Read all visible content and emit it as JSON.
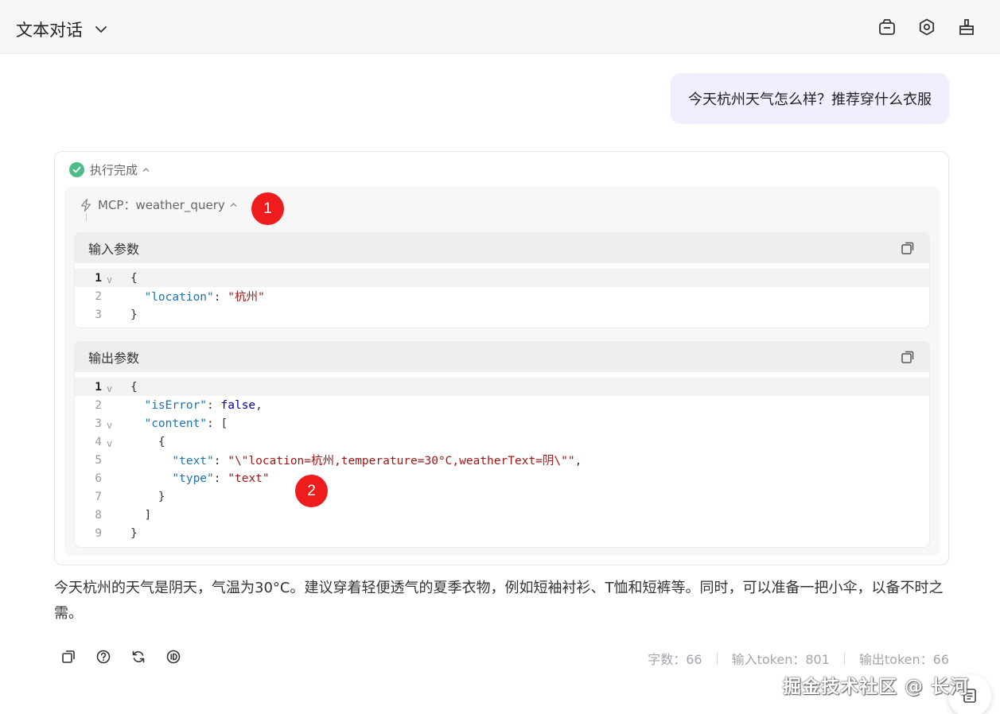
{
  "header": {
    "title": "文本对话",
    "icons": [
      "bag-icon",
      "gear-icon",
      "broom-icon"
    ]
  },
  "user_message": "今天杭州天气怎么样？推荐穿什么衣服",
  "execution": {
    "status": "执行完成",
    "status_color": "#4cbd87",
    "mcp_label": "MCP：weather_query",
    "badge_1": "1",
    "badge_2": "2",
    "input_block": {
      "title": "输入参数",
      "line_numbers": [
        "1",
        "2",
        "3"
      ]
    },
    "output_block": {
      "title": "输出参数",
      "line_numbers": [
        "1",
        "2",
        "3",
        "4",
        "5",
        "6",
        "7",
        "8",
        "9"
      ]
    },
    "input_code": {
      "key_location": "\"location\"",
      "val_location": "\"杭州\""
    },
    "output_code": {
      "key_isError": "\"isError\"",
      "val_isError": "false",
      "key_content": "\"content\"",
      "key_text": "\"text\"",
      "val_text": "\"\\\"location=杭州,temperature=30°C,weatherText=阴\\\"\"",
      "key_type": "\"type\"",
      "val_type": "\"text\""
    },
    "symbols": {
      "open_brace": "{",
      "close_brace": "}",
      "open_bracket": "[",
      "close_bracket": "]",
      "colon": ": ",
      "comma": ",",
      "fold_marker": "v"
    }
  },
  "answer": "今天杭州的天气是阴天，气温为30°C。建议穿着轻便透气的夏季衣物，例如短袖衬衫、T恤和短裤等。同时，可以准备一把小伞，以备不时之需。",
  "stats": {
    "chars": "字数：66",
    "input_tokens": "输入token：801",
    "output_tokens": "输出token：66"
  },
  "watermark": "掘金技术社区 @ 长河",
  "colors": {
    "accent_bubble": "#f1efff",
    "badge": "#ee1c1c",
    "json_key": "#1d73b3",
    "json_string": "#a31515"
  }
}
